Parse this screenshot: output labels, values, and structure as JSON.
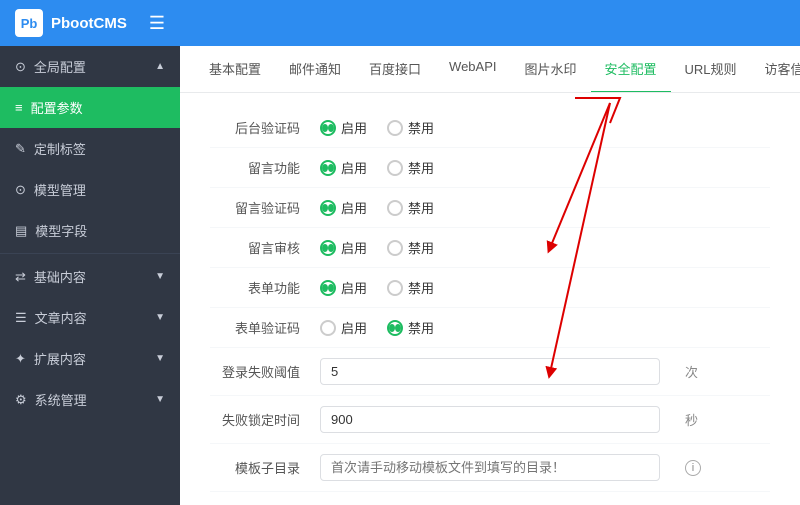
{
  "header": {
    "logo_text": "PbootCMS",
    "logo_short": "Pb",
    "menu_icon": "☰"
  },
  "sidebar": {
    "sections": [
      {
        "id": "global-config",
        "icon": "⊙",
        "label": "全局配置",
        "arrow": "▲",
        "active": false,
        "children": [
          {
            "id": "config-params",
            "icon": "≡",
            "label": "配置参数",
            "active": true
          },
          {
            "id": "custom-tags",
            "icon": "✎",
            "label": "定制标签",
            "active": false
          },
          {
            "id": "template-mgmt",
            "icon": "⊙",
            "label": "模型管理",
            "active": false
          },
          {
            "id": "model-fields",
            "icon": "▤",
            "label": "模型字段",
            "active": false
          }
        ]
      },
      {
        "id": "basic-content",
        "icon": "⇄",
        "label": "基础内容",
        "arrow": "▼",
        "active": false
      },
      {
        "id": "article-content",
        "icon": "☰",
        "label": "文章内容",
        "arrow": "▼",
        "active": false
      },
      {
        "id": "extend-content",
        "icon": "✦",
        "label": "扩展内容",
        "arrow": "▼",
        "active": false
      },
      {
        "id": "system-mgmt",
        "icon": "⚙",
        "label": "系统管理",
        "arrow": "▼",
        "active": false
      }
    ]
  },
  "tabs": [
    {
      "id": "basic",
      "label": "基本配置",
      "active": false
    },
    {
      "id": "email",
      "label": "邮件通知",
      "active": false
    },
    {
      "id": "baidu",
      "label": "百度接口",
      "active": false
    },
    {
      "id": "webapi",
      "label": "WebAPI",
      "active": false
    },
    {
      "id": "watermark",
      "label": "图片水印",
      "active": false
    },
    {
      "id": "security",
      "label": "安全配置",
      "active": true
    },
    {
      "id": "url",
      "label": "URL规则",
      "active": false
    },
    {
      "id": "visitor",
      "label": "访客信息",
      "active": false
    }
  ],
  "form": {
    "rows": [
      {
        "id": "backend-captcha",
        "label": "后台验证码",
        "type": "radio",
        "options": [
          {
            "label": "启用",
            "checked": true
          },
          {
            "label": "禁用",
            "checked": false
          }
        ]
      },
      {
        "id": "comment-func",
        "label": "留言功能",
        "type": "radio",
        "options": [
          {
            "label": "启用",
            "checked": true
          },
          {
            "label": "禁用",
            "checked": false
          }
        ]
      },
      {
        "id": "comment-captcha",
        "label": "留言验证码",
        "type": "radio",
        "options": [
          {
            "label": "启用",
            "checked": true
          },
          {
            "label": "禁用",
            "checked": false
          }
        ]
      },
      {
        "id": "comment-audit",
        "label": "留言审核",
        "type": "radio",
        "options": [
          {
            "label": "启用",
            "checked": true
          },
          {
            "label": "禁用",
            "checked": false
          }
        ]
      },
      {
        "id": "form-func",
        "label": "表单功能",
        "type": "radio",
        "options": [
          {
            "label": "启用",
            "checked": true
          },
          {
            "label": "禁用",
            "checked": false
          }
        ]
      },
      {
        "id": "form-captcha",
        "label": "表单验证码",
        "type": "radio",
        "options": [
          {
            "label": "启用",
            "checked": false
          },
          {
            "label": "禁用",
            "checked": true
          }
        ]
      },
      {
        "id": "login-fail-threshold",
        "label": "登录失败阈值",
        "type": "input",
        "value": "5",
        "unit": "次"
      },
      {
        "id": "lock-time",
        "label": "失败锁定时间",
        "type": "input",
        "value": "900",
        "unit": "秒"
      },
      {
        "id": "template-subdir",
        "label": "模板子目录",
        "type": "input",
        "placeholder": "首次请手动移动模板文件到填写的目录！",
        "value": "",
        "has_info": true
      }
    ]
  },
  "colors": {
    "active_green": "#1ebc61",
    "primary_blue": "#2d8cf0",
    "sidebar_bg": "#303744",
    "red_arrow": "#e00"
  }
}
